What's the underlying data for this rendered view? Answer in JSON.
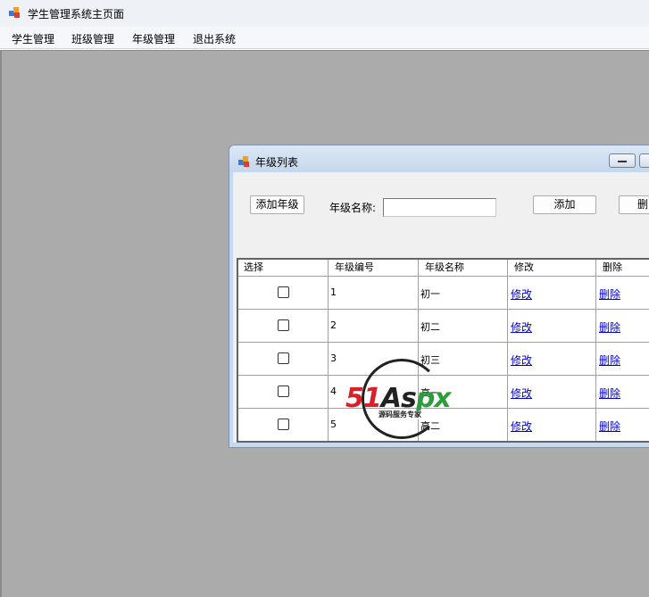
{
  "window": {
    "title": "学生管理系统主页面"
  },
  "menu": [
    "学生管理",
    "班级管理",
    "年级管理",
    "退出系统"
  ],
  "child_window": {
    "title": "年级列表",
    "toolbar": {
      "add_grade_button": "添加年级",
      "grade_name_label": "年级名称:",
      "grade_name_value": "",
      "add_button": "添加",
      "delete_button": "删"
    },
    "grid": {
      "headers": [
        "选择",
        "年级编号",
        "年级名称",
        "修改",
        "删除"
      ],
      "rows": [
        {
          "id": "1",
          "name": "初一",
          "edit": "修改",
          "delete": "删除"
        },
        {
          "id": "2",
          "name": "初二",
          "edit": "修改",
          "delete": "删除"
        },
        {
          "id": "3",
          "name": "初三",
          "edit": "修改",
          "delete": "删除"
        },
        {
          "id": "4",
          "name": "高一",
          "edit": "修改",
          "delete": "删除"
        },
        {
          "id": "5",
          "name": "高二",
          "edit": "修改",
          "delete": "删除"
        }
      ]
    }
  },
  "watermark": {
    "brand_red": "51",
    "brand_dark": "As",
    "brand_green": "px",
    "tagline": "源码服务专家"
  },
  "colors": {
    "mdi_background": "#ababab",
    "link": "#0000c8",
    "brand_red": "#d8202a",
    "brand_green": "#2d9c3c"
  },
  "icons": {
    "app": "app-window-icon",
    "minimize": "minimize-icon"
  }
}
